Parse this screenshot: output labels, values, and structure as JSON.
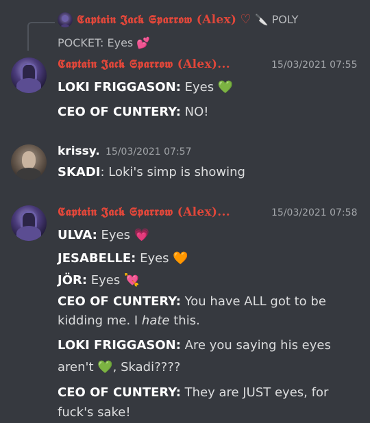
{
  "reply": {
    "author": "𝕮𝖆𝖕𝖙𝖆𝖎𝖓 𝕵𝖆𝖈𝖐 𝕾𝖕𝖆𝖗𝖗𝖔𝖜 (Alex)",
    "heart": "♡",
    "knife": "🔪",
    "tail1": "POLY",
    "tail2": "POCKET: Eyes",
    "tail2_emoji": "💕"
  },
  "messages": [
    {
      "author": "𝕮𝖆𝖕𝖙𝖆𝖎𝖓 𝕵𝖆𝖈𝖐 𝕾𝖕𝖆𝖗𝖗𝖔𝖜 (Alex)...",
      "timestamp": "15/03/2021 07:55",
      "lines": [
        {
          "speaker": "LOKI FRIGGASON:",
          "text": " Eyes ",
          "emoji": "💚"
        },
        {
          "speaker": "CEO OF CUNTERY:",
          "text": " NO!"
        }
      ]
    },
    {
      "author": "krissy.",
      "timestamp": "15/03/2021 07:57",
      "lines": [
        {
          "speaker": "SKADI",
          "text": ": Loki's simp is showing"
        }
      ]
    },
    {
      "author": "𝕮𝖆𝖕𝖙𝖆𝖎𝖓 𝕵𝖆𝖈𝖐 𝕾𝖕𝖆𝖗𝖗𝖔𝖜 (Alex)...",
      "timestamp": "15/03/2021 07:58",
      "lines": [
        {
          "speaker": "ULVA:",
          "text": " Eyes ",
          "emoji": "💗"
        },
        {
          "speaker": "JESABELLE:",
          "text": " Eyes ",
          "emoji": "🧡"
        },
        {
          "speaker": "JÖR:",
          "text": " Eyes ",
          "emoji": "💘"
        },
        {
          "speaker": "CEO OF CUNTERY:",
          "text": " You have ALL got to be",
          "cont1": "kidding me. I ",
          "italic": "hate",
          "cont2": " this."
        },
        {
          "speaker": "LOKI FRIGGASON:",
          "text": " Are you saying his eyes",
          "cont1": "aren't ",
          "emoji": "💚",
          "cont2": ", Skadi????"
        },
        {
          "speaker": "CEO OF CUNTERY:",
          "text": " They are JUST eyes, for",
          "cont1": "fuck's sake!"
        }
      ]
    }
  ],
  "colors": {
    "background": "#36393f",
    "role_red": "#e0473a",
    "text": "#dcddde",
    "muted": "#a3a6aa"
  }
}
